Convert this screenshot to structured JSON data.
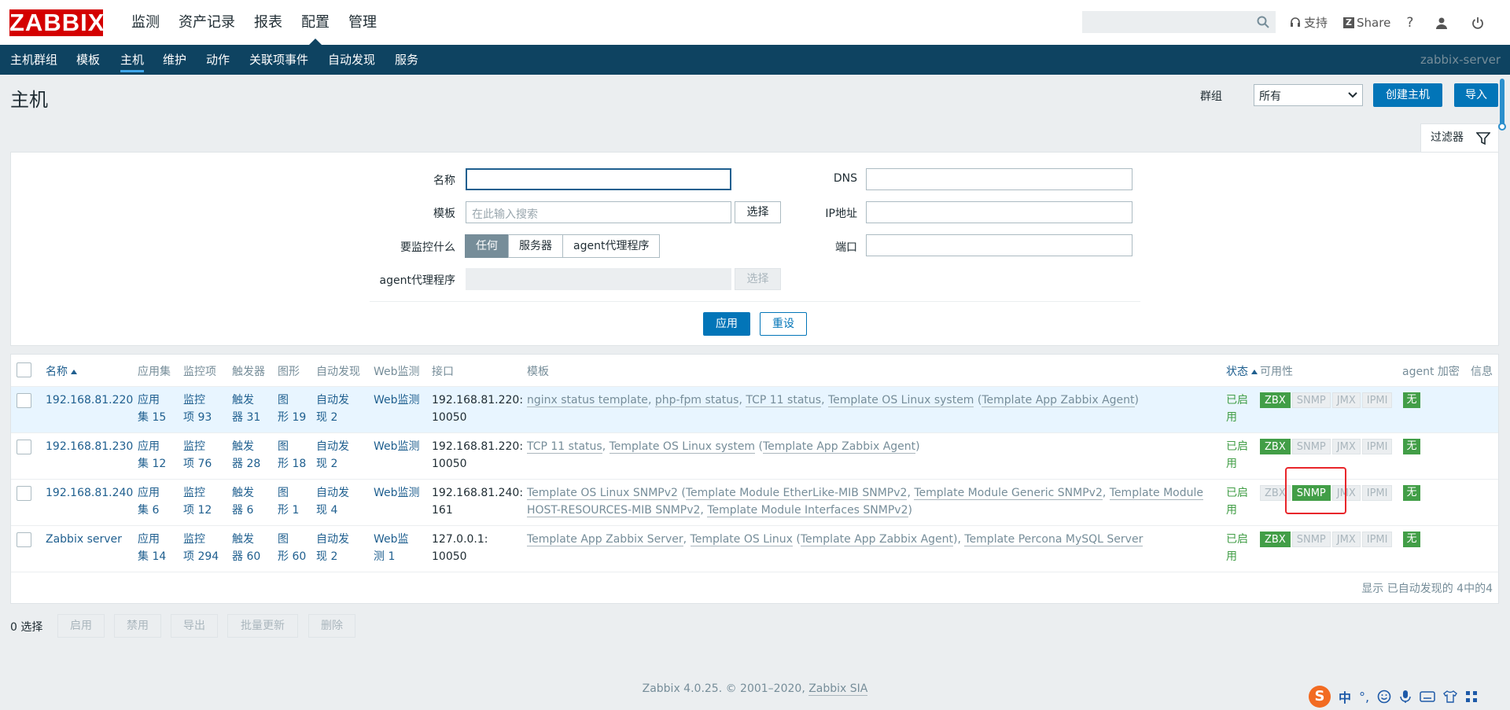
{
  "brand": {
    "logo": "ZABBIX"
  },
  "mainmenu": [
    "监测",
    "资产记录",
    "报表",
    "配置",
    "管理"
  ],
  "topbar": {
    "support": "支持",
    "share": "Share",
    "help": "?"
  },
  "subnav": {
    "items": [
      "主机群组",
      "模板",
      "主机",
      "维护",
      "动作",
      "关联项事件",
      "自动发现",
      "服务"
    ],
    "server": "zabbix-server"
  },
  "page": {
    "title": "主机",
    "group_label": "群组",
    "group_value": "所有",
    "create_host": "创建主机",
    "import": "导入",
    "filter_tab": "过滤器"
  },
  "filter": {
    "name_label": "名称",
    "name_value": "",
    "template_label": "模板",
    "template_placeholder": "在此输入搜索",
    "select_label": "选择",
    "monitor_label": "要监控什么",
    "monitor_options": [
      "任何",
      "服务器",
      "agent代理程序"
    ],
    "proxy_label": "agent代理程序",
    "dns_label": "DNS",
    "ip_label": "IP地址",
    "port_label": "端口",
    "apply": "应用",
    "reset": "重设"
  },
  "table": {
    "headers": [
      "名称",
      "应用集",
      "监控项",
      "触发器",
      "图形",
      "自动发现",
      "Web监测",
      "接口",
      "模板",
      "状态",
      "可用性",
      "agent 加密",
      "信息"
    ],
    "rows": [
      {
        "name": "192.168.81.220",
        "app1": "应用",
        "app2": "集 15",
        "item1": "监控",
        "item2": "项 93",
        "trig1": "触发",
        "trig2": "器 31",
        "graph1": "图",
        "graph2": "形 19",
        "disc1": "自动发",
        "disc2": "现 2",
        "web1": "Web监测",
        "web2": "",
        "if1": "192.168.81.220:",
        "if2": "10050",
        "templates": [
          "nginx status template",
          ", ",
          "php-fpm status",
          ", ",
          "TCP 11 status",
          ", ",
          "Template OS Linux system",
          " (",
          "Template App Zabbix Agent",
          ")"
        ],
        "status1": "已启",
        "status2": "用",
        "zbx": "ZBX",
        "snmp": "SNMP",
        "jmx": "JMX",
        "ipmi": "IPMI",
        "encryption": "无"
      },
      {
        "name": "192.168.81.230",
        "app1": "应用",
        "app2": "集 12",
        "item1": "监控",
        "item2": "项 76",
        "trig1": "触发",
        "trig2": "器 28",
        "graph1": "图",
        "graph2": "形 18",
        "disc1": "自动发",
        "disc2": "现 2",
        "web1": "Web监测",
        "web2": "",
        "if1": "192.168.81.220:",
        "if2": "10050",
        "templates": [
          "TCP 11 status",
          ", ",
          "Template OS Linux system",
          " (",
          "Template App Zabbix Agent",
          ")"
        ],
        "status1": "已启",
        "status2": "用",
        "zbx": "ZBX",
        "snmp": "SNMP",
        "jmx": "JMX",
        "ipmi": "IPMI",
        "encryption": "无"
      },
      {
        "name": "192.168.81.240",
        "app1": "应用",
        "app2": "集 6",
        "item1": "监控",
        "item2": "项 12",
        "trig1": "触发",
        "trig2": "器 6",
        "graph1": "图",
        "graph2": "形 1",
        "disc1": "自动发",
        "disc2": "现 4",
        "web1": "Web监测",
        "web2": "",
        "if1": "192.168.81.240:",
        "if2": "161",
        "templates_line1": [
          "Template OS Linux SNMPv2",
          " (",
          "Template Module EtherLike-MIB SNMPv2",
          ", ",
          "Template Module Generic SNMPv2",
          ", ",
          "Template Module"
        ],
        "templates_line2": [
          "HOST-RESOURCES-MIB SNMPv2",
          ", ",
          "Template Module Interfaces SNMPv2",
          ")"
        ],
        "status1": "已启",
        "status2": "用",
        "zbx": "ZBX",
        "snmp": "SNMP",
        "jmx": "JMX",
        "ipmi": "IPMI",
        "encryption": "无"
      },
      {
        "name": "Zabbix server",
        "app1": "应用",
        "app2": "集 14",
        "item1": "监控",
        "item2": "项 294",
        "trig1": "触发",
        "trig2": "器 60",
        "graph1": "图",
        "graph2": "形 60",
        "disc1": "自动发",
        "disc2": "现 2",
        "web1": "Web监",
        "web2": "测 1",
        "if1": "127.0.0.1:",
        "if2": "10050",
        "templates": [
          "Template App Zabbix Server",
          ", ",
          "Template OS Linux",
          " (",
          "Template App Zabbix Agent",
          "), ",
          "Template Percona MySQL Server"
        ],
        "status1": "已启",
        "status2": "用",
        "zbx": "ZBX",
        "snmp": "SNMP",
        "jmx": "JMX",
        "ipmi": "IPMI",
        "encryption": "无"
      }
    ],
    "footer": "显示 已自动发现的 4中的4"
  },
  "actions": {
    "selected": "0 选择",
    "buttons": [
      "启用",
      "禁用",
      "导出",
      "批量更新",
      "删除"
    ]
  },
  "copyright": {
    "text": "Zabbix 4.0.25. © 2001–2020, ",
    "link": "Zabbix SIA"
  },
  "ime": {
    "logo": "S",
    "lang": "中",
    "punct": "°,"
  },
  "colors": {
    "nav": "#0e4361",
    "primary": "#0275b8",
    "green": "#429e47",
    "logo": "#d40000",
    "highlight_box": "#e8262b"
  }
}
